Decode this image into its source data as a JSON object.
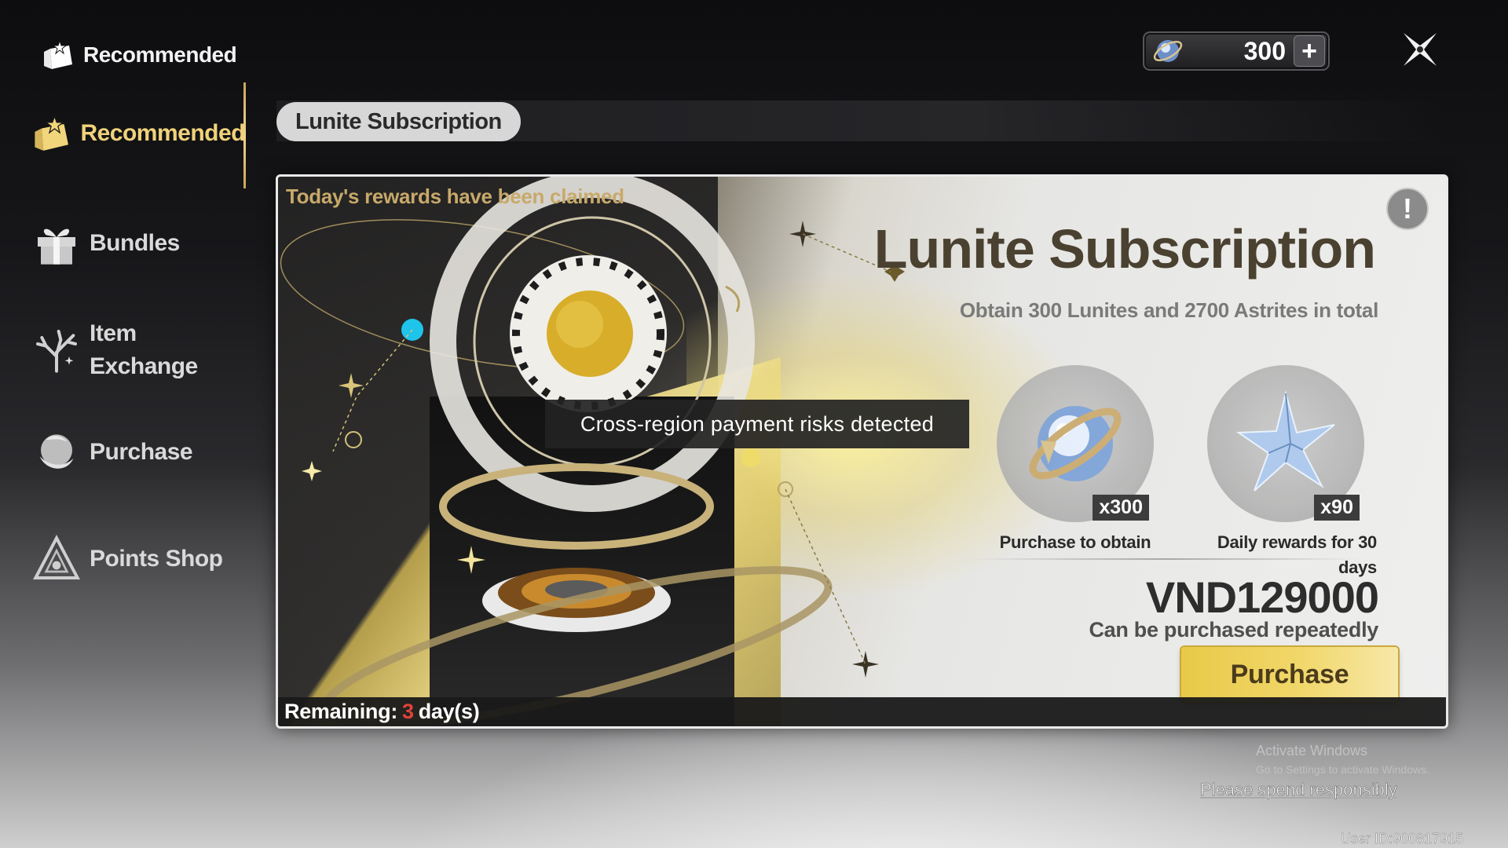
{
  "sidebar": {
    "header_label": "Recommended",
    "items": [
      {
        "label": "Recommended",
        "icon": "star-folder-icon",
        "active": true
      },
      {
        "label": "Bundles",
        "icon": "gift-icon"
      },
      {
        "label": "Item\nExchange",
        "icon": "coral-icon"
      },
      {
        "label": "Purchase",
        "icon": "orb-icon"
      },
      {
        "label": "Points Shop",
        "icon": "triangle-icon"
      }
    ]
  },
  "topbar": {
    "currency_icon": "lunite-icon",
    "currency_value": "300",
    "add_label": "+"
  },
  "tabs": [
    {
      "label": "Lunite Subscription"
    }
  ],
  "card": {
    "claimed_text": "Today's rewards have been claimed",
    "title": "Lunite Subscription",
    "subtitle": "Obtain 300 Lunites and 2700 Astrites in total",
    "info_label": "!",
    "risk_notice": "Cross-region payment risks detected",
    "rewards": [
      {
        "qty": "x300",
        "caption": "Purchase to obtain",
        "icon": "lunite-orb-icon"
      },
      {
        "qty": "x90",
        "caption": "Daily rewards for 30 days",
        "icon": "astrite-crystal-icon"
      }
    ],
    "price": "VND129000",
    "repeat_note": "Can be purchased repeatedly",
    "purchase_label": "Purchase",
    "remaining_prefix": "Remaining:",
    "remaining_days": "3",
    "remaining_suffix": "day(s)"
  },
  "footer": {
    "spend_note": "Please spend responsibly",
    "activate_title": "Activate Windows",
    "activate_sub": "Go to Settings to activate Windows.",
    "user_id": "User ID:900817915"
  },
  "colors": {
    "accent_gold": "#efd27a",
    "purchase_button": "#f1d76a",
    "remaining_days": "#e0433a"
  }
}
